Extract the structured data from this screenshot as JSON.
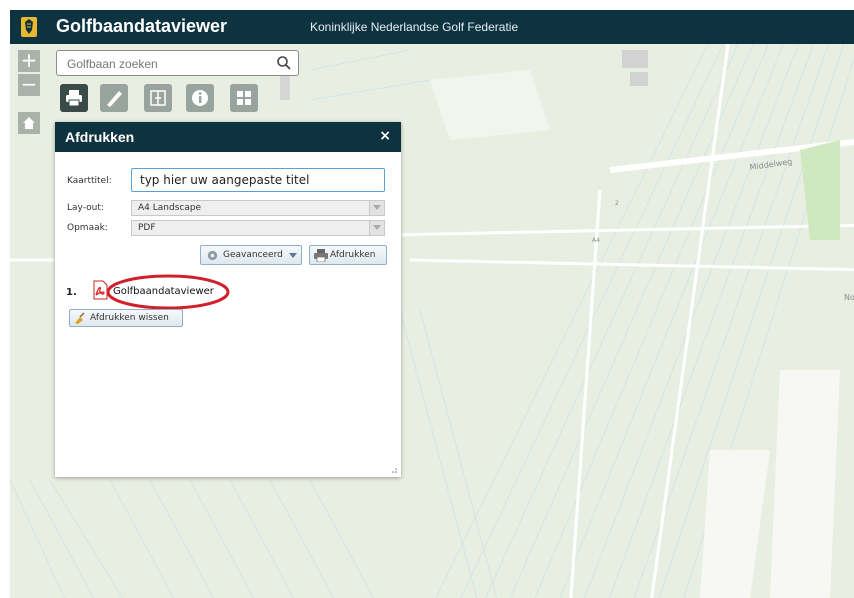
{
  "app": {
    "title": "Golfbaandataviewer",
    "subtitle": "Koninklijke Nederlandse Golf Federatie"
  },
  "map_controls": {
    "zoom_in": "+",
    "zoom_out": "−"
  },
  "search": {
    "placeholder": "Golfbaan zoeken",
    "value": ""
  },
  "toolbar": {
    "items": [
      {
        "name": "print",
        "icon": "printer-icon",
        "active": true
      },
      {
        "name": "measure",
        "icon": "ruler-icon",
        "active": false
      },
      {
        "name": "compare",
        "icon": "split-screen-icon",
        "active": false
      },
      {
        "name": "info",
        "icon": "info-icon",
        "active": false
      },
      {
        "name": "layers",
        "icon": "grid-icon",
        "active": false
      }
    ]
  },
  "map_labels": {
    "road1": "Middelweg",
    "road2": "No",
    "marker1": "2",
    "marker2": "A4"
  },
  "print_panel": {
    "title": "Afdrukken",
    "close": "×",
    "fields": {
      "map_title_label": "Kaarttitel:",
      "map_title_value": "typ hier uw aangepaste titel",
      "layout_label": "Lay-out:",
      "layout_value": "A4 Landscape",
      "format_label": "Opmaak:",
      "format_value": "PDF"
    },
    "advanced_button": "Geavanceerd",
    "print_button": "Afdrukken",
    "results": [
      {
        "number": "1.",
        "name": "Golfbaandataviewer"
      }
    ],
    "clear_button": "Afdrukken wissen"
  },
  "colors": {
    "header_bg": "#0e3340",
    "map_bg": "#e8efe2",
    "highlight_ring": "#d0202a",
    "input_focus": "#5aa1d6"
  }
}
